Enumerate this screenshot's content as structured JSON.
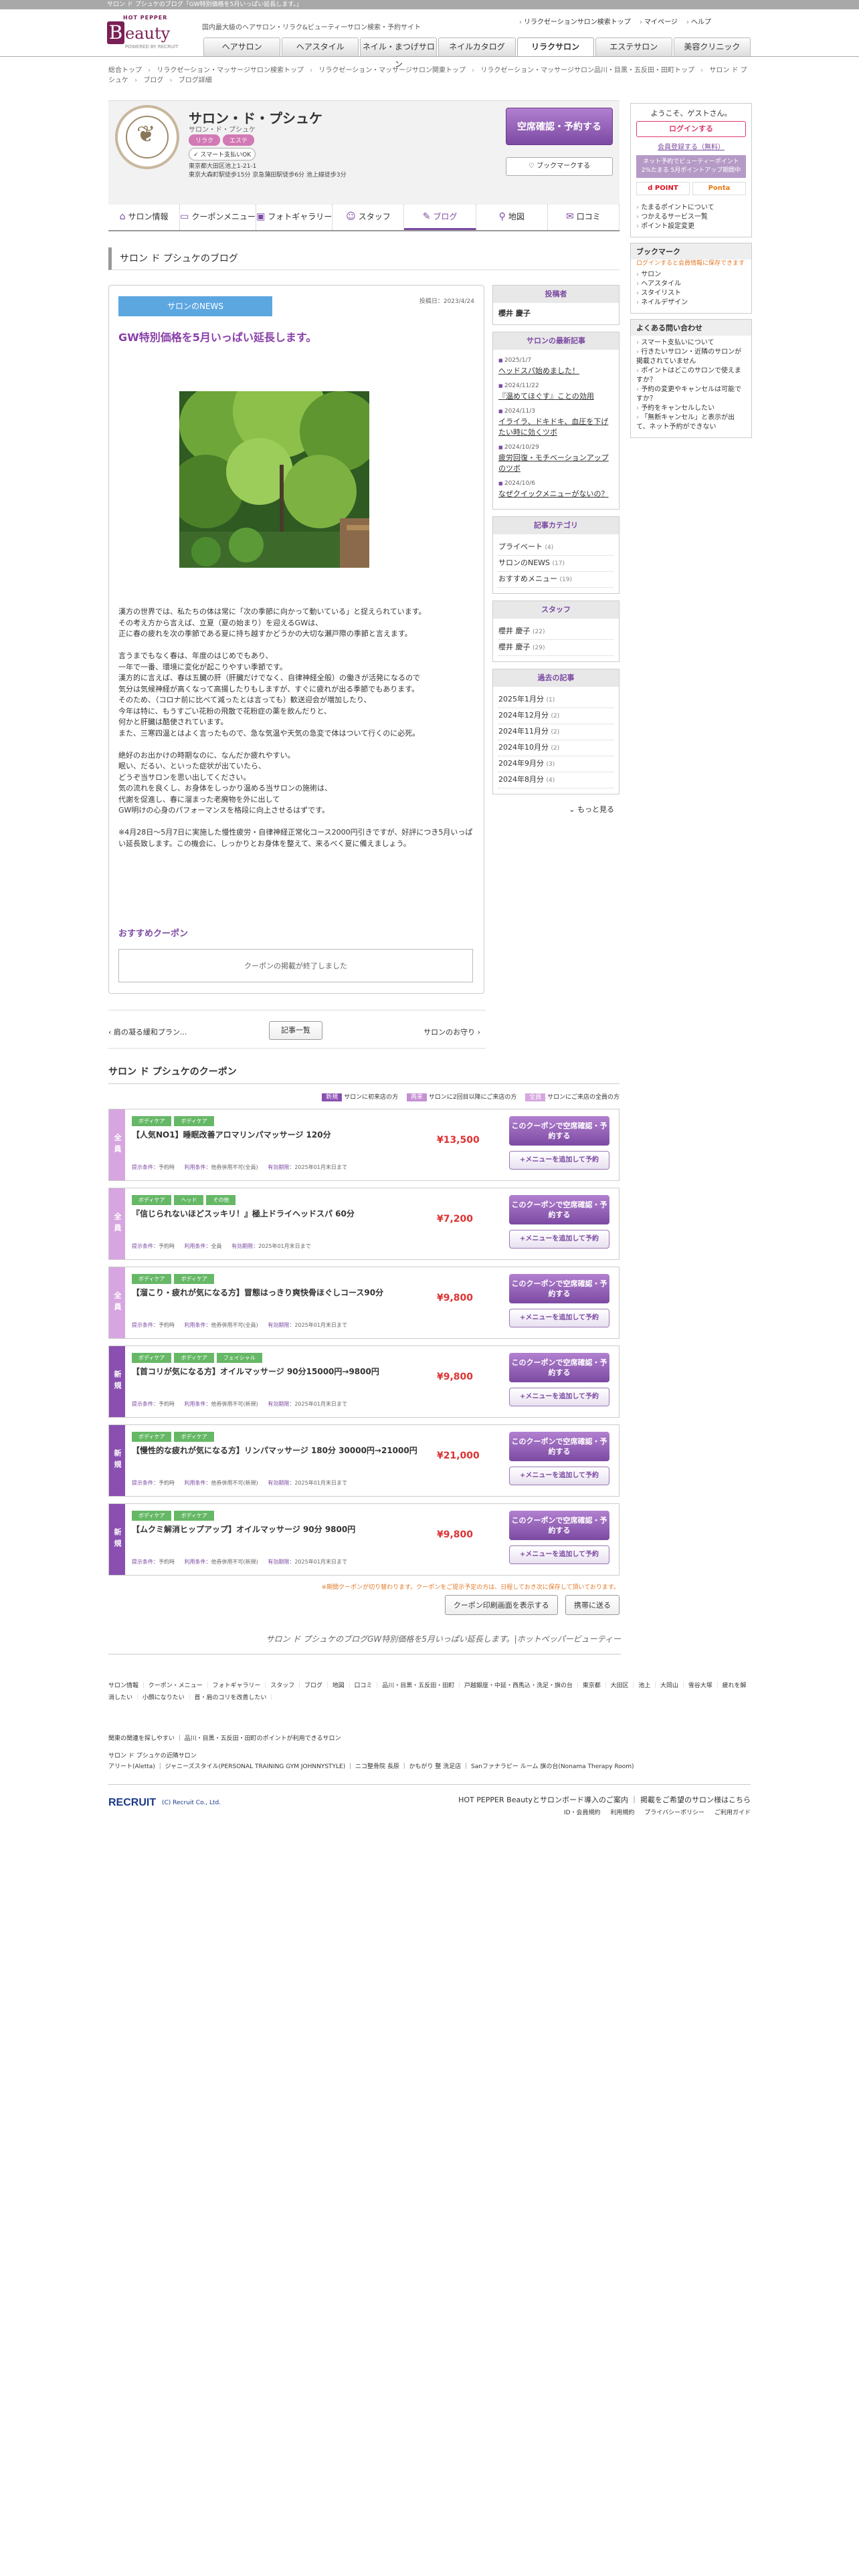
{
  "top_strip": "サロン ド プシュケのブログ「GW特別価格を5月いっぱい延長します。」",
  "header": {
    "tagline": "国内最大級のヘアサロン・リラク&ビューティーサロン検索・予約サイト",
    "toplinks": [
      "リラクゼーションサロン検索トップ",
      "マイページ",
      "ヘルプ"
    ],
    "nav": [
      "ヘアサロン",
      "ヘアスタイル",
      "ネイル・まつげサロン",
      "ネイルカタログ",
      "リラクサロン",
      "エステサロン",
      "美容クリニック"
    ]
  },
  "breadcrumb": [
    "総合トップ",
    "リラクゼーション・マッサージサロン検索トップ",
    "リラクゼーション・マッサージサロン関東トップ",
    "リラクゼーション・マッサージサロン品川・目黒・五反田・田町トップ",
    "サロン ド プシュケ",
    "ブログ",
    "ブログ詳細"
  ],
  "salon": {
    "name": "サロン・ド・プシュケ",
    "kana": "サロン・ド・プシュケ",
    "tags": [
      "リラク",
      "エステ"
    ],
    "badge": "スマート支払いOK",
    "address_lines": [
      "東京都大田区池上1-21-1",
      "東京大森町駅徒歩15分 京急蒲田駅徒歩6分 池上線徒歩3分"
    ],
    "reserve_label": "空席確認・予約する",
    "bookmark_label": "ブックマークする"
  },
  "tabs": [
    {
      "label": "サロン情報",
      "icon": "home-icon"
    },
    {
      "label": "クーポンメニュー",
      "icon": "coupon-icon"
    },
    {
      "label": "フォトギャラリー",
      "icon": "photo-icon"
    },
    {
      "label": "スタッフ",
      "icon": "staff-icon"
    },
    {
      "label": "ブログ",
      "icon": "pen-icon"
    },
    {
      "label": "地図",
      "icon": "map-pin-icon"
    },
    {
      "label": "口コミ",
      "icon": "review-icon"
    }
  ],
  "section_title": "サロン ド プシュケのブログ",
  "article": {
    "category": "サロンのNEWS",
    "date": "投稿日：2023/4/24",
    "title": "GW特別価格を5月いっぱい延長します。",
    "body": "漢方の世界では、私たちの体は常に「次の季節に向かって動いている」と捉えられています。\nその考え方から言えば、立夏（夏の始まり）を迎えるGWは、\n正に春の疲れを次の季節である夏に持ち越すかどうかの大切な瀬戸際の季節と言えます。\n\n言うまでもなく春は、年度のはじめでもあり、\n一年で一番、環境に変化が起こりやすい季節です。\n漢方的に言えば、春は五臓の肝（肝臓だけでなく、自律神経全般）の働きが活発になるので\n気分は気候神経が高くなって高揚したりもしますが、すぐに疲れが出る季節でもあります。\nそのため、（コロナ前に比べて減ったとは言っても）歓送迎会が増加したり、\n今年は特に、もうすごい花粉の飛散で花粉症の薬を飲んだりと、\n何かと肝臓は酷使されています。\nまた、三寒四温とはよく言ったもので、急な気温や天気の急変で体はついて行くのに必死。\n\n絶好のお出かけの時期なのに、なんだか疲れやすい。\n眠い、だるい、といった症状が出ていたら、\nどうぞ当サロンを思い出してください。\n気の流れを良くし、お身体をしっかり温める当サロンの施術は、\n代謝を促進し、春に溜まった老廃物を外に出して\nGW明けの心身のパフォーマンスを格段に向上させるはずです。\n\n※4月28日～5月7日に実施した慢性疲労・自律神経正常化コース2000円引きですが、好評につき5月いっぱい延長致します。この機会に、しっかりとお身体を整えて、来るべく夏に備えましょう。",
    "coupon_heading": "おすすめクーポン",
    "coupon_ended": "クーポンの掲載が終了しました"
  },
  "pager": {
    "prev": "肩の凝る緩和プラン...",
    "list": "記事一覧",
    "next": "サロンのお守り"
  },
  "right_sidebar": {
    "author_heading": "投稿者",
    "author": "櫻井 慶子",
    "recent_heading": "サロンの最新記事",
    "recent": [
      {
        "date": "2025/1/7",
        "title": "ヘッドスパ始めました！"
      },
      {
        "date": "2024/11/22",
        "title": "『温めてほぐす』ことの効用"
      },
      {
        "date": "2024/11/3",
        "title": "イライラ、ドキドキ、血圧を下げたい時に効くツボ"
      },
      {
        "date": "2024/10/29",
        "title": "疲労回復・モチベーションアップのツボ"
      },
      {
        "date": "2024/10/6",
        "title": "なぜクイックメニューがないの？"
      }
    ],
    "category_heading": "記事カテゴリ",
    "categories": [
      {
        "name": "プライベート",
        "count": "(4)"
      },
      {
        "name": "サロンのNEWS",
        "count": "(17)"
      },
      {
        "name": "おすすめメニュー",
        "count": "(19)"
      }
    ],
    "staff_heading": "スタッフ",
    "staff": [
      {
        "name": "櫻井 慶子",
        "count": "(22)"
      },
      {
        "name": "櫻井 慶子",
        "count": "(29)"
      }
    ],
    "archive_heading": "過去の記事",
    "archive": [
      {
        "name": "2025年1月分",
        "count": "(1)"
      },
      {
        "name": "2024年12月分",
        "count": "(2)"
      },
      {
        "name": "2024年11月分",
        "count": "(2)"
      },
      {
        "name": "2024年10月分",
        "count": "(2)"
      },
      {
        "name": "2024年9月分",
        "count": "(3)"
      },
      {
        "name": "2024年8月分",
        "count": "(4)"
      }
    ],
    "more": "もっと見る"
  },
  "left_sidebar": {
    "welcome": "ようこそ、ゲストさん。",
    "login": "ログインする",
    "register": "会員登録する（無料）",
    "promo": "ネット予約でビューティーポイント2%たまる 5月ポイントアップ期間中",
    "point_logos": [
      "d POINT",
      "Ponta"
    ],
    "links": [
      "たまるポイントについて",
      "つかえるサービス一覧",
      "ポイント設定変更"
    ],
    "bookmark_heading": "ブックマーク",
    "bookmark_note": "ログインすると会員情報に保存できます",
    "bookmark_items": [
      "サロン",
      "ヘアスタイル",
      "スタイリスト",
      "ネイルデザイン"
    ],
    "faq_heading": "よくある問い合わせ",
    "faq": [
      "スマート支払いについて",
      "行きたいサロン・近隣のサロンが掲載されていません",
      "ポイントはどこのサロンで使えますか？",
      "予約の変更やキャンセルは可能ですか？",
      "予約をキャンセルしたい",
      "「無断キャンセル」と表示が出て、ネット予約ができない"
    ]
  },
  "coupons": {
    "heading": "サロン ド プシュケのクーポン",
    "legend": [
      {
        "label": "新規",
        "text": "サロンに初来店の方",
        "color": "#8a4fb0"
      },
      {
        "label": "再来",
        "text": "サロンに2回目以降にご来店の方",
        "color": "#c58fd3"
      },
      {
        "label": "全員",
        "text": "サロンにご来店の全員の方",
        "color": "#d7a6e0"
      }
    ],
    "items": [
      {
        "side": "全員",
        "side_color": "#d7a6e0",
        "cats": [
          "ボディケア",
          "ボディケア"
        ],
        "name": "【人気NO1】睡眠改善アロマリンパマッサージ 120分",
        "price": "¥13,500",
        "meta1": "予約時",
        "meta2": "他券併用不可(全員)",
        "meta3": "2025年01月末日まで"
      },
      {
        "side": "全員",
        "side_color": "#d7a6e0",
        "cats": [
          "ボディケア",
          "ヘッド",
          "その他"
        ],
        "name": "『信じられないほどスッキリ！』極上ドライヘッドスパ 60分",
        "price": "¥7,200",
        "meta1": "予約時",
        "meta2": "全員",
        "meta3": "2025年01月末日まで"
      },
      {
        "side": "全員",
        "side_color": "#d7a6e0",
        "cats": [
          "ボディケア",
          "ボディケア"
        ],
        "name": "【溜こり・疲れが気になる方】冒態はっきり爽快骨ほぐしコース90分",
        "price": "¥9,800",
        "meta1": "予約時",
        "meta2": "他券併用不可(全員)",
        "meta3": "2025年01月末日まで"
      },
      {
        "side": "新規",
        "side_color": "#8a4fb0",
        "cats": [
          "ボディケア",
          "ボディケア",
          "フェイシャル"
        ],
        "name": "【首コリが気になる方】オイルマッサージ 90分15000円→9800円",
        "price": "¥9,800",
        "meta1": "予約時",
        "meta2": "他券併用不可(新規)",
        "meta3": "2025年01月末日まで"
      },
      {
        "side": "新規",
        "side_color": "#8a4fb0",
        "cats": [
          "ボディケア",
          "ボディケア"
        ],
        "name": "【慢性的な疲れが気になる方】リンパマッサージ 180分 30000円→21000円",
        "price": "¥21,000",
        "meta1": "予約時",
        "meta2": "他券併用不可(新規)",
        "meta3": "2025年01月末日まで"
      },
      {
        "side": "新規",
        "side_color": "#8a4fb0",
        "cats": [
          "ボディケア",
          "ボディケア"
        ],
        "name": "【ムクミ解消ヒップアップ】オイルマッサージ 90分 9800円",
        "price": "¥9,800",
        "meta1": "予約時",
        "meta2": "他券併用不可(新規)",
        "meta3": "2025年01月末日まで"
      }
    ],
    "btn1": "このクーポンで空席確認・予約する",
    "btn2": "+メニューを追加して予約",
    "label_cond": "提示条件：",
    "label_use": "利用条件：",
    "label_exp": "有効期限：",
    "note": "※期間クーポンが切り替わります。クーポンをご提示予定の方は、日程しておき次に保存して頂いております。",
    "print_btn": "クーポン印刷画面を表示する",
    "mobile_btn": "携帯に送る"
  },
  "page_title_bottom": "サロン ド プシュケのブログGW特別価格を5月いっぱい延長します。|ホットペッパービューティー",
  "footer": {
    "links": [
      "サロン情報",
      "クーポン・メニュー",
      "フォトギャラリー",
      "スタッフ",
      "ブログ",
      "地図",
      "口コミ",
      "品川・目黒・五反田・田町",
      "戸越銀座・中延・西馬込・洗足・旗の台",
      "東京都",
      "大田区",
      "池上",
      "大岡山",
      "雪谷大塚",
      "疲れを解消したい",
      "小顔になりたい",
      "首・肩のコリを改善したい"
    ],
    "area_link": "関東の関連を探しやすい ｜ 品川・目黒・五反田・田町のポイントが利用できるサロン",
    "nearby_heading": "サロン ド プシュケの近隣サロン",
    "nearby": "アリート(Aletta) ｜ ジャニーズスタイル(PERSONAL TRAINING GYM JOHNNYSTYLE) ｜ ニコ整骨院 長原 ｜ かもがり 整 洗足店 ｜ Sanファナラピー ルーム 旗の台(Nonama Therapy Room)",
    "recruit": "RECRUIT",
    "copyright": "(C) Recruit Co., Ltd.",
    "r1": "HOT PEPPER Beautyとサロンボード導入のご案内 ｜ 掲載をご希望のサロン様はこちら",
    "r2": [
      "ID・会員規約",
      "利用規約",
      "プライバシーポリシー",
      "ご利用ガイド"
    ]
  }
}
